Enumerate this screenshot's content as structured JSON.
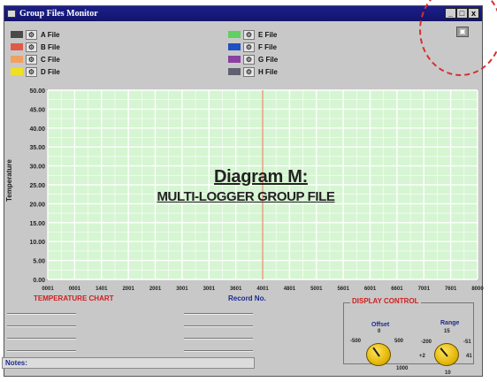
{
  "window": {
    "title": "Group Files Monitor",
    "buttons": {
      "minimize": "_",
      "maximize": "□",
      "close": "x"
    }
  },
  "legend": [
    {
      "label": "A File",
      "color": "#4a4a4a"
    },
    {
      "label": "B File",
      "color": "#e05a4a"
    },
    {
      "label": "C File",
      "color": "#f0a060"
    },
    {
      "label": "D File",
      "color": "#f0e020"
    },
    {
      "label": "E File",
      "color": "#60d060"
    },
    {
      "label": "F File",
      "color": "#2050c0"
    },
    {
      "label": "G File",
      "color": "#8a40a0"
    },
    {
      "label": "H File",
      "color": "#606070"
    }
  ],
  "chart_data": {
    "type": "line",
    "title": "",
    "xlabel": "Record No.",
    "ylabel": "Temperature",
    "x_ticks": [
      "0001",
      "0001",
      "1401",
      "2001",
      "2001",
      "3001",
      "3001",
      "3601",
      "4001",
      "4801",
      "5001",
      "5601",
      "6001",
      "6601",
      "7001",
      "7601",
      "8000"
    ],
    "y_ticks": [
      "0.00",
      "5.00",
      "10.00",
      "15.00",
      "20.00",
      "25.00",
      "30.00",
      "35.00",
      "40.00",
      "45.00",
      "50.00"
    ],
    "ylim": [
      0,
      50
    ],
    "grid": true,
    "cursor_x": "4001",
    "series": []
  },
  "annotation": {
    "title": "Diagram M:",
    "subtitle": "MULTI-LOGGER GROUP FILE"
  },
  "x_left_caption": "TEMPERATURE CHART",
  "display_control": {
    "title": "DISPLAY CONTROL",
    "offset": {
      "label": "Offset",
      "ticks": [
        "-500",
        "0",
        "500",
        "1000"
      ]
    },
    "range": {
      "label": "Range",
      "value": "15",
      "ticks": [
        "-200",
        "-51",
        "41",
        "+2",
        "10"
      ]
    }
  },
  "status": {
    "label": "Notes:"
  },
  "colors": {
    "plot_bg": "#d6f5d2",
    "grid": "#ffffff",
    "cursor": "#e07050",
    "title_bar": "#1c1f8a"
  }
}
